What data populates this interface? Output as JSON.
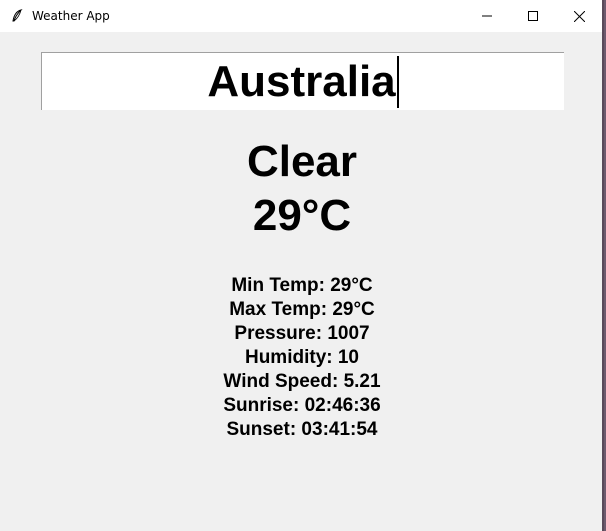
{
  "window": {
    "title": "Weather App",
    "app_icon": "feather-icon"
  },
  "search": {
    "value": "Australia"
  },
  "weather": {
    "condition": "Clear",
    "temperature": "29°C"
  },
  "details": [
    "Min Temp: 29°C",
    "Max Temp: 29°C",
    "Pressure: 1007",
    "Humidity: 10",
    "Wind Speed: 5.21",
    "Sunrise: 02:46:36",
    "Sunset: 03:41:54"
  ]
}
